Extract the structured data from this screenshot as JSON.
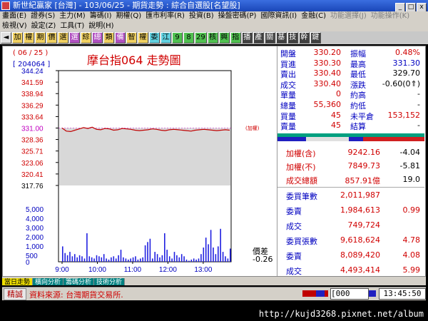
{
  "window": {
    "title": "新世紀贏家 [台灣] - 103/06/25 - 期貨走勢 : 綜合自選股[名望股]",
    "buttons": [
      "_",
      "□",
      "x"
    ]
  },
  "menu1": [
    "畫面(E)",
    "證券(S)",
    "主力(M)",
    "籌碼(I)",
    "期權(Q)",
    "匯市利率(R)",
    "投資(B)",
    "操盤密碼(P)",
    "國際資訊(I)",
    "金融(C)",
    "功能選擇(J)",
    "功能操作(K)"
  ],
  "menu2": [
    "檢視(V)",
    "設定(Z)",
    "工具(T)",
    "說明(H)"
  ],
  "toolbar": [
    {
      "label": "◄",
      "style": "gray"
    },
    {
      "label": "加",
      "style": "gold"
    },
    {
      "label": "權",
      "style": "gold"
    },
    {
      "label": "期",
      "style": "gold"
    },
    {
      "label": "價",
      "style": "gold"
    },
    {
      "label": "選",
      "style": "gold"
    },
    {
      "label": "選",
      "style": "purple"
    },
    {
      "label": "綜",
      "style": "gold"
    },
    {
      "label": "總",
      "style": "purple"
    },
    {
      "label": "類",
      "style": "gold"
    },
    {
      "label": "備",
      "style": "purple"
    },
    {
      "label": "智",
      "style": "gold"
    },
    {
      "label": "權",
      "style": "gold"
    },
    {
      "label": "委",
      "style": "cyan"
    },
    {
      "label": "江",
      "style": "cyan"
    },
    {
      "label": "9",
      "style": "green"
    },
    {
      "label": "8",
      "style": "green"
    },
    {
      "label": "29",
      "style": "green"
    },
    {
      "label": "核",
      "style": "green"
    },
    {
      "label": "興",
      "style": "green"
    },
    {
      "label": "指",
      "style": "green"
    },
    {
      "label": "播",
      "style": "dark"
    },
    {
      "label": "產",
      "style": "dark"
    },
    {
      "label": "關",
      "style": "dark"
    },
    {
      "label": "基",
      "style": "dark"
    },
    {
      "label": "技",
      "style": "dark"
    },
    {
      "label": "幹",
      "style": "dark"
    },
    {
      "label": "鍵",
      "style": "dark"
    }
  ],
  "chart_header": {
    "date": "( 06 / 25 )",
    "code": "[ 204064 ]",
    "title": "摩台指064  走勢圖",
    "weighted_tag": "(加權)"
  },
  "chart_data": {
    "type": "line",
    "y_ticks": [
      "344.24",
      "341.59",
      "338.94",
      "336.29",
      "333.64",
      "331.00",
      "328.36",
      "325.71",
      "323.06",
      "320.41",
      "317.76"
    ],
    "ylim": [
      317.76,
      344.24
    ],
    "reference_price": 331.0,
    "x_ticks": [
      "9:00",
      "10:00",
      "11:00",
      "12:00",
      "13:00"
    ],
    "price_series": [
      331.0,
      330.3,
      330.2,
      330.5,
      330.8,
      331.1,
      330.9,
      331.2,
      330.7,
      330.6,
      330.9,
      330.8,
      330.5,
      330.6,
      330.9,
      330.8,
      330.7,
      330.5,
      330.4,
      330.5,
      330.6,
      330.8,
      330.7,
      330.5,
      330.4,
      330.6,
      330.7,
      330.6,
      330.5,
      330.4,
      330.3,
      330.5,
      330.6,
      330.7,
      330.6,
      330.5,
      330.4,
      330.5,
      330.6,
      330.5
    ],
    "volume_ticks": [
      "5,000",
      "4,000",
      "3,000",
      "2,000",
      "1,000",
      "500",
      "0"
    ],
    "volume_series": [
      1400,
      800,
      600,
      900,
      500,
      700,
      400,
      600,
      500,
      300,
      2600,
      500,
      400,
      300,
      600,
      500,
      400,
      700,
      300,
      200,
      400,
      500,
      300,
      600,
      1100,
      400,
      300,
      200,
      300,
      400,
      500,
      200,
      300,
      400,
      1500,
      1800,
      2100,
      300,
      900,
      700,
      400,
      600,
      2600,
      1100,
      500,
      300,
      900,
      600,
      400,
      700,
      500,
      200,
      100,
      200,
      300,
      200,
      300,
      700,
      1300,
      2200,
      1600,
      2900,
      1300,
      700,
      1400,
      3000,
      900,
      500,
      300,
      1200
    ],
    "diff_label": "價差",
    "diff_value": "-0.26"
  },
  "quote": {
    "rows": [
      {
        "k1": "開盤",
        "v1": "330.20",
        "k2": "振幅",
        "v2": "0.48%",
        "c2": "red"
      },
      {
        "k1": "買進",
        "v1": "330.30",
        "k2": "最高",
        "v2": "331.30",
        "c2": "blue"
      },
      {
        "k1": "賣出",
        "v1": "330.40",
        "k2": "最低",
        "v2": "329.70",
        "c2": "black"
      },
      {
        "k1": "成交",
        "v1": "330.40",
        "k2": "漲跌",
        "v2": "-0.60(0⇑)",
        "c2": "black"
      },
      {
        "k1": "單量",
        "v1": "0",
        "k2": "約高",
        "v2": "-",
        "c2": "black"
      },
      {
        "k1": "總量",
        "v1": "55,360",
        "k2": "約低",
        "v2": "-",
        "c2": "black"
      },
      {
        "k1": "買量",
        "v1": "45",
        "k2": "未平倉",
        "v2": "153,152",
        "c2": "red"
      },
      {
        "k1": "賣量",
        "v1": "45",
        "k2": "結算",
        "v2": "-",
        "c2": "black"
      }
    ]
  },
  "index": {
    "rows": [
      {
        "k": "加權(含)",
        "v": "9242.16",
        "c": "-4.04"
      },
      {
        "k": "加權(不)",
        "v": "7849.73",
        "c": "-5.81"
      },
      {
        "k": "成交總額",
        "v": "857.91億",
        "c": "19.0"
      }
    ]
  },
  "orders": {
    "rows": [
      {
        "k": "委買筆數",
        "v": "2,011,987",
        "c": ""
      },
      {
        "k": "委賣",
        "v": "1,984,613",
        "c": "0.99"
      },
      {
        "k": "成交",
        "v": "749,724",
        "c": ""
      },
      {
        "k": "委買張數",
        "v": "9,618,624",
        "c": "4.78"
      },
      {
        "k": "委賣",
        "v": "8,089,420",
        "c": "4.08"
      },
      {
        "k": "成交",
        "v": "4,493,414",
        "c": "5.99"
      }
    ]
  },
  "tabs": [
    "當日走勢",
    "橫向分析",
    "籌碼分析",
    "技術分析"
  ],
  "status": {
    "badge": "精誠",
    "source": "資料來源: 台灣期貨交易所.",
    "counter": "[000",
    "time": "13:45:50"
  },
  "watermark": "http://kujd3268.pixnet.net/album",
  "colors": {
    "price_line": "#c00000",
    "volume_bar": "#2020e0",
    "ref_band": "#d8d8d8"
  }
}
